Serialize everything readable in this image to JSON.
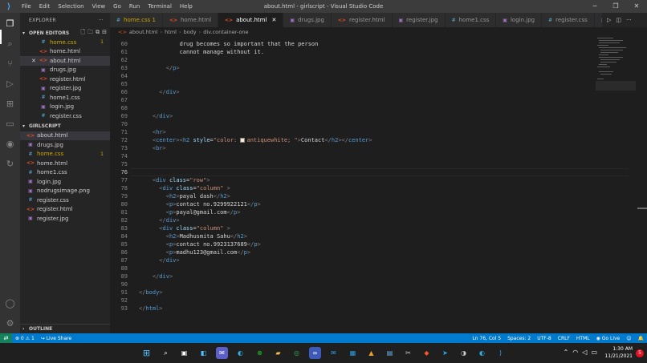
{
  "window": {
    "title": "about.html - girlscript - Visual Studio Code",
    "menu": [
      "File",
      "Edit",
      "Selection",
      "View",
      "Go",
      "Run",
      "Terminal",
      "Help"
    ],
    "controls": [
      "─",
      "❐",
      "✕"
    ]
  },
  "explorer": {
    "header": "EXPLORER",
    "more": "···",
    "open_editors": {
      "label": "OPEN EDITORS",
      "files": [
        {
          "name": "home.css",
          "type": "css",
          "badge": "1"
        },
        {
          "name": "home.html",
          "type": "html",
          "badge": ""
        },
        {
          "name": "about.html",
          "type": "html",
          "badge": "",
          "close": "✕"
        },
        {
          "name": "drugs.jpg",
          "type": "jpg",
          "badge": ""
        },
        {
          "name": "register.html",
          "type": "html",
          "badge": ""
        },
        {
          "name": "register.jpg",
          "type": "jpg",
          "badge": ""
        },
        {
          "name": "home1.css",
          "type": "css",
          "badge": ""
        },
        {
          "name": "login.jpg",
          "type": "jpg",
          "badge": ""
        },
        {
          "name": "register.css",
          "type": "css",
          "badge": ""
        }
      ]
    },
    "folder": {
      "label": "GIRLSCRIPT",
      "files": [
        {
          "name": "about.html",
          "type": "html",
          "badge": ""
        },
        {
          "name": "drugs.jpg",
          "type": "jpg",
          "badge": ""
        },
        {
          "name": "home.css",
          "type": "css",
          "badge": "1"
        },
        {
          "name": "home.html",
          "type": "html",
          "badge": ""
        },
        {
          "name": "home1.css",
          "type": "css",
          "badge": ""
        },
        {
          "name": "login.jpg",
          "type": "jpg",
          "badge": ""
        },
        {
          "name": "nodrugsimage.png",
          "type": "jpg",
          "badge": ""
        },
        {
          "name": "register.css",
          "type": "css",
          "badge": ""
        },
        {
          "name": "register.html",
          "type": "html",
          "badge": ""
        },
        {
          "name": "register.jpg",
          "type": "jpg",
          "badge": ""
        }
      ]
    },
    "outline": "OUTLINE"
  },
  "tabs": [
    {
      "label": "home.css 1",
      "type": "css"
    },
    {
      "label": "home.html",
      "type": "html"
    },
    {
      "label": "about.html",
      "type": "html",
      "active": true
    },
    {
      "label": "drugs.jpg",
      "type": "jpg"
    },
    {
      "label": "register.html",
      "type": "html"
    },
    {
      "label": "register.jpg",
      "type": "jpg"
    },
    {
      "label": "home1.css",
      "type": "css"
    },
    {
      "label": "login.jpg",
      "type": "jpg"
    },
    {
      "label": "register.css",
      "type": "css"
    },
    {
      "label": "nodru",
      "type": "jpg"
    }
  ],
  "breadcrumb": [
    "about.html",
    "html",
    "body",
    "div.container-one"
  ],
  "editor": {
    "current_line": 76,
    "lines": [
      {
        "n": "60",
        "parts": [
          [
            "t-text",
            "            drug becomes so important that the person"
          ]
        ]
      },
      {
        "n": "61",
        "parts": [
          [
            "t-text",
            "            cannot manage without it."
          ]
        ]
      },
      {
        "n": "62",
        "parts": []
      },
      {
        "n": "63",
        "parts": [
          [
            "t-text",
            "        "
          ],
          [
            "t-tag",
            "</"
          ],
          [
            "t-name",
            "p"
          ],
          [
            "t-tag",
            ">"
          ]
        ]
      },
      {
        "n": "64",
        "parts": []
      },
      {
        "n": "65",
        "parts": []
      },
      {
        "n": "66",
        "parts": [
          [
            "t-text",
            "      "
          ],
          [
            "t-tag",
            "</"
          ],
          [
            "t-name",
            "div"
          ],
          [
            "t-tag",
            ">"
          ]
        ]
      },
      {
        "n": "67",
        "parts": []
      },
      {
        "n": "68",
        "parts": []
      },
      {
        "n": "69",
        "parts": [
          [
            "t-text",
            "    "
          ],
          [
            "t-tag",
            "</"
          ],
          [
            "t-name",
            "div"
          ],
          [
            "t-tag",
            ">"
          ]
        ]
      },
      {
        "n": "70",
        "parts": []
      },
      {
        "n": "71",
        "parts": [
          [
            "t-text",
            "    "
          ],
          [
            "t-tag",
            "<"
          ],
          [
            "t-name",
            "hr"
          ],
          [
            "t-tag",
            ">"
          ]
        ]
      },
      {
        "n": "72",
        "parts": [
          [
            "t-text",
            "    "
          ],
          [
            "t-tag",
            "<"
          ],
          [
            "t-name",
            "center"
          ],
          [
            "t-tag",
            "><"
          ],
          [
            "t-name",
            "h2"
          ],
          [
            "t-text",
            " "
          ],
          [
            "t-attr",
            "style"
          ],
          [
            "t-text",
            "="
          ],
          [
            "t-str",
            "\"color: "
          ],
          [
            "swatch",
            ""
          ],
          [
            "t-str",
            "antiquewhite; \""
          ],
          [
            "t-tag",
            ">"
          ],
          [
            "t-text",
            "Contact"
          ],
          [
            "t-tag",
            "</"
          ],
          [
            "t-name",
            "h2"
          ],
          [
            "t-tag",
            "></"
          ],
          [
            "t-name",
            "center"
          ],
          [
            "t-tag",
            ">"
          ]
        ]
      },
      {
        "n": "73",
        "parts": [
          [
            "t-text",
            "    "
          ],
          [
            "t-tag",
            "<"
          ],
          [
            "t-name",
            "br"
          ],
          [
            "t-tag",
            ">"
          ]
        ]
      },
      {
        "n": "74",
        "parts": []
      },
      {
        "n": "75",
        "parts": []
      },
      {
        "n": "76",
        "parts": []
      },
      {
        "n": "77",
        "parts": [
          [
            "t-text",
            "    "
          ],
          [
            "t-tag",
            "<"
          ],
          [
            "t-name",
            "div"
          ],
          [
            "t-text",
            " "
          ],
          [
            "t-attr",
            "class"
          ],
          [
            "t-text",
            "="
          ],
          [
            "t-str",
            "\"row\""
          ],
          [
            "t-tag",
            ">"
          ]
        ]
      },
      {
        "n": "78",
        "parts": [
          [
            "t-text",
            "      "
          ],
          [
            "t-tag",
            "<"
          ],
          [
            "t-name",
            "div"
          ],
          [
            "t-text",
            " "
          ],
          [
            "t-attr",
            "class"
          ],
          [
            "t-text",
            "="
          ],
          [
            "t-str",
            "\"column\""
          ],
          [
            "t-text",
            " "
          ],
          [
            "t-tag",
            ">"
          ]
        ]
      },
      {
        "n": "79",
        "parts": [
          [
            "t-text",
            "        "
          ],
          [
            "t-tag",
            "<"
          ],
          [
            "t-name",
            "h2"
          ],
          [
            "t-tag",
            ">"
          ],
          [
            "t-text",
            "payal dash"
          ],
          [
            "t-tag",
            "</"
          ],
          [
            "t-name",
            "h2"
          ],
          [
            "t-tag",
            ">"
          ]
        ]
      },
      {
        "n": "80",
        "parts": [
          [
            "t-text",
            "        "
          ],
          [
            "t-tag",
            "<"
          ],
          [
            "t-name",
            "p"
          ],
          [
            "t-tag",
            ">"
          ],
          [
            "t-text",
            "contact no.9299922121"
          ],
          [
            "t-tag",
            "</"
          ],
          [
            "t-name",
            "p"
          ],
          [
            "t-tag",
            ">"
          ]
        ]
      },
      {
        "n": "81",
        "parts": [
          [
            "t-text",
            "        "
          ],
          [
            "t-tag",
            "<"
          ],
          [
            "t-name",
            "p"
          ],
          [
            "t-tag",
            ">"
          ],
          [
            "t-text",
            "payal@gmail.com"
          ],
          [
            "t-tag",
            "</"
          ],
          [
            "t-name",
            "p"
          ],
          [
            "t-tag",
            ">"
          ]
        ]
      },
      {
        "n": "82",
        "parts": [
          [
            "t-text",
            "      "
          ],
          [
            "t-tag",
            "</"
          ],
          [
            "t-name",
            "div"
          ],
          [
            "t-tag",
            ">"
          ]
        ]
      },
      {
        "n": "83",
        "parts": [
          [
            "t-text",
            "      "
          ],
          [
            "t-tag",
            "<"
          ],
          [
            "t-name",
            "div"
          ],
          [
            "t-text",
            " "
          ],
          [
            "t-attr",
            "class"
          ],
          [
            "t-text",
            "="
          ],
          [
            "t-str",
            "\"column\""
          ],
          [
            "t-text",
            " "
          ],
          [
            "t-tag",
            ">"
          ]
        ]
      },
      {
        "n": "84",
        "parts": [
          [
            "t-text",
            "        "
          ],
          [
            "t-tag",
            "<"
          ],
          [
            "t-name",
            "h2"
          ],
          [
            "t-tag",
            ">"
          ],
          [
            "t-text",
            "Madhusmita Sahu"
          ],
          [
            "t-tag",
            "</"
          ],
          [
            "t-name",
            "h2"
          ],
          [
            "t-tag",
            ">"
          ]
        ]
      },
      {
        "n": "85",
        "parts": [
          [
            "t-text",
            "        "
          ],
          [
            "t-tag",
            "<"
          ],
          [
            "t-name",
            "p"
          ],
          [
            "t-tag",
            ">"
          ],
          [
            "t-text",
            "contact no.9923137689"
          ],
          [
            "t-tag",
            "</"
          ],
          [
            "t-name",
            "p"
          ],
          [
            "t-tag",
            ">"
          ]
        ]
      },
      {
        "n": "86",
        "parts": [
          [
            "t-text",
            "        "
          ],
          [
            "t-tag",
            "<"
          ],
          [
            "t-name",
            "p"
          ],
          [
            "t-tag",
            ">"
          ],
          [
            "t-text",
            "madhu123@gmail.com"
          ],
          [
            "t-tag",
            "</"
          ],
          [
            "t-name",
            "p"
          ],
          [
            "t-tag",
            ">"
          ]
        ]
      },
      {
        "n": "87",
        "parts": [
          [
            "t-text",
            "      "
          ],
          [
            "t-tag",
            "</"
          ],
          [
            "t-name",
            "div"
          ],
          [
            "t-tag",
            ">"
          ]
        ]
      },
      {
        "n": "88",
        "parts": []
      },
      {
        "n": "89",
        "parts": [
          [
            "t-text",
            "    "
          ],
          [
            "t-tag",
            "</"
          ],
          [
            "t-name",
            "div"
          ],
          [
            "t-tag",
            ">"
          ]
        ]
      },
      {
        "n": "90",
        "parts": []
      },
      {
        "n": "91",
        "parts": [
          [
            "t-tag",
            "</"
          ],
          [
            "t-name",
            "body"
          ],
          [
            "t-tag",
            ">"
          ]
        ]
      },
      {
        "n": "92",
        "parts": []
      },
      {
        "n": "93",
        "parts": [
          [
            "t-tag",
            "</"
          ],
          [
            "t-name",
            "html"
          ],
          [
            "t-tag",
            ">"
          ]
        ]
      }
    ]
  },
  "status": {
    "remote": "⇄",
    "errors": "⊗ 0 ⚠ 1",
    "live_share": "Live Share",
    "position": "Ln 76, Col 5",
    "spaces": "Spaces: 2",
    "encoding": "UTF-8",
    "eol": "CRLF",
    "language": "HTML",
    "go_live": "Go Live"
  },
  "taskbar": {
    "time": "1:30 AM",
    "date": "11/21/2021",
    "notifications": "5"
  },
  "colors": {
    "accent": "#007acc",
    "titlebar": "#3c3c3c",
    "sidebar": "#252526",
    "editor": "#1e1e1e"
  }
}
